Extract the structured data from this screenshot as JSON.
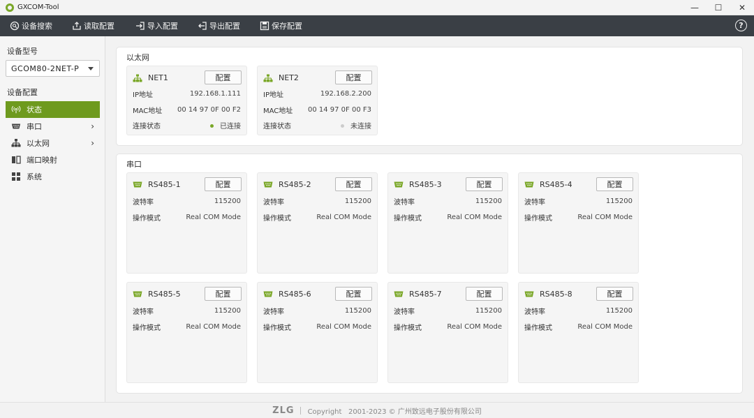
{
  "window": {
    "title": "GXCOM-Tool",
    "minimize": "—",
    "maximize": "☐",
    "close": "✕"
  },
  "toolbar": {
    "search": "设备搜索",
    "read": "读取配置",
    "import": "导入配置",
    "export": "导出配置",
    "save": "保存配置",
    "help": "?"
  },
  "sidebar": {
    "model_label": "设备型号",
    "model_value": "GCOM80-2NET-P",
    "config_label": "设备配置",
    "items": [
      {
        "label": "状态",
        "icon": "antenna-icon",
        "active": true
      },
      {
        "label": "串口",
        "icon": "serial-port-icon",
        "chevron": "›"
      },
      {
        "label": "以太网",
        "icon": "network-icon",
        "chevron": "›"
      },
      {
        "label": "端口映射",
        "icon": "port-mapping-icon"
      },
      {
        "label": "系统",
        "icon": "grid-icon"
      }
    ]
  },
  "ethernet": {
    "title": "以太网",
    "cards": [
      {
        "name": "NET1",
        "btn": "配置",
        "ip_label": "IP地址",
        "ip": "192.168.1.111",
        "mac_label": "MAC地址",
        "mac": "00 14 97 0F 00 F2",
        "status_label": "连接状态",
        "status": "已连接",
        "status_color": "#7aa728"
      },
      {
        "name": "NET2",
        "btn": "配置",
        "ip_label": "IP地址",
        "ip": "192.168.2.200",
        "mac_label": "MAC地址",
        "mac": "00 14 97 0F 00 F3",
        "status_label": "连接状态",
        "status": "未连接",
        "status_color": "#cccccc"
      }
    ]
  },
  "serial": {
    "title": "串口",
    "cards": [
      {
        "name": "RS485-1",
        "btn": "配置",
        "baud_label": "波特率",
        "baud": "115200",
        "mode_label": "操作模式",
        "mode": "Real COM Mode"
      },
      {
        "name": "RS485-2",
        "btn": "配置",
        "baud_label": "波特率",
        "baud": "115200",
        "mode_label": "操作模式",
        "mode": "Real COM Mode"
      },
      {
        "name": "RS485-3",
        "btn": "配置",
        "baud_label": "波特率",
        "baud": "115200",
        "mode_label": "操作模式",
        "mode": "Real COM Mode"
      },
      {
        "name": "RS485-4",
        "btn": "配置",
        "baud_label": "波特率",
        "baud": "115200",
        "mode_label": "操作模式",
        "mode": "Real COM Mode"
      },
      {
        "name": "RS485-5",
        "btn": "配置",
        "baud_label": "波特率",
        "baud": "115200",
        "mode_label": "操作模式",
        "mode": "Real COM Mode"
      },
      {
        "name": "RS485-6",
        "btn": "配置",
        "baud_label": "波特率",
        "baud": "115200",
        "mode_label": "操作模式",
        "mode": "Real COM Mode"
      },
      {
        "name": "RS485-7",
        "btn": "配置",
        "baud_label": "波特率",
        "baud": "115200",
        "mode_label": "操作模式",
        "mode": "Real COM Mode"
      },
      {
        "name": "RS485-8",
        "btn": "配置",
        "baud_label": "波特率",
        "baud": "115200",
        "mode_label": "操作模式",
        "mode": "Real COM Mode"
      }
    ]
  },
  "footer": {
    "logo": "ZLG",
    "copyright": "Copyright   2001-2023 © 广州致远电子股份有限公司"
  },
  "colors": {
    "accent": "#6e9a1e",
    "toolbar_bg": "#3a3f45"
  }
}
